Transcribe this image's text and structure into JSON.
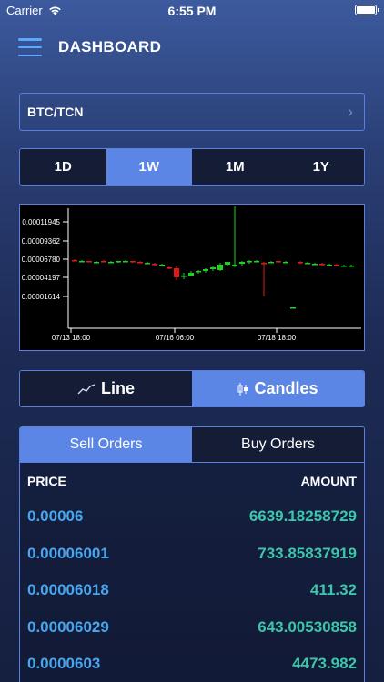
{
  "status_bar": {
    "carrier": "Carrier",
    "time": "6:55 PM"
  },
  "header": {
    "title": "DASHBOARD"
  },
  "pair": {
    "label": "BTC/TCN"
  },
  "range_tabs": [
    {
      "label": "1D",
      "active": false
    },
    {
      "label": "1W",
      "active": true
    },
    {
      "label": "1M",
      "active": false
    },
    {
      "label": "1Y",
      "active": false
    }
  ],
  "chart_data": {
    "type": "candlestick",
    "y_tick_labels": [
      "0.00011945",
      "0.00009362",
      "0.00006780",
      "0.00004197",
      "0.00001614"
    ],
    "x_tick_labels": [
      "07/13 18:00",
      "07/16 06:00",
      "07/18 18:00"
    ],
    "colors": {
      "up": "#19d619",
      "down": "#e01a1a",
      "background": "#000000"
    }
  },
  "view_toggle": {
    "line_label": "Line",
    "candles_label": "Candles",
    "active": "candles"
  },
  "orders": {
    "tabs": [
      {
        "label": "Sell Orders",
        "active": true
      },
      {
        "label": "Buy Orders",
        "active": false
      }
    ],
    "columns": {
      "price": "PRICE",
      "amount": "AMOUNT"
    },
    "rows": [
      {
        "price": "0.00006",
        "amount": "6639.18258729"
      },
      {
        "price": "0.00006001",
        "amount": "733.85837919"
      },
      {
        "price": "0.00006018",
        "amount": "411.32"
      },
      {
        "price": "0.00006029",
        "amount": "643.00530858"
      },
      {
        "price": "0.0000603",
        "amount": "4473.982"
      }
    ]
  }
}
